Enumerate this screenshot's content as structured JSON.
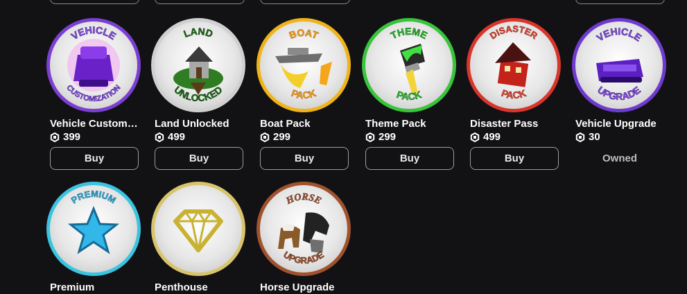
{
  "items": [
    {
      "name": "Vehicle Customiz...",
      "price": "399",
      "action": "Buy",
      "badge_top": "VEHICLE",
      "badge_bottom": "CUSTOMIZATION",
      "ring_color": "#7b3fd1",
      "icon": "purple-car-icon"
    },
    {
      "name": "Land Unlocked",
      "price": "499",
      "action": "Buy",
      "badge_top": "LAND",
      "badge_bottom": "UNLOCKED",
      "ring_color": "#c8c8c8",
      "icon": "house-on-island-icon"
    },
    {
      "name": "Boat Pack",
      "price": "299",
      "action": "Buy",
      "badge_top": "BOAT",
      "badge_bottom": "PACK",
      "ring_color": "#f0b419",
      "icon": "boats-icon"
    },
    {
      "name": "Theme Pack",
      "price": "299",
      "action": "Buy",
      "badge_top": "THEME",
      "badge_bottom": "PACK",
      "ring_color": "#39c43b",
      "icon": "paintbrush-icon"
    },
    {
      "name": "Disaster Pass",
      "price": "499",
      "action": "Buy",
      "badge_top": "DISASTER",
      "badge_bottom": "PACK",
      "ring_color": "#d9352b",
      "icon": "broken-house-icon"
    },
    {
      "name": "Vehicle Upgrade",
      "price": "30",
      "action": "Owned",
      "badge_top": "VEHICLE",
      "badge_bottom": "UPGRADE",
      "ring_color": "#6f3ad0",
      "icon": "purple-car-icon"
    },
    {
      "name": "Premium",
      "badge_top": "PREMIUM",
      "badge_bottom": "",
      "ring_color": "#3bc4e0",
      "icon": "star-icon"
    },
    {
      "name": "Penthouse",
      "badge_top": "",
      "badge_bottom": "",
      "ring_color": "#d8c46a",
      "icon": "diamond-icon"
    },
    {
      "name": "Horse Upgrade",
      "badge_top": "HORSE",
      "badge_bottom": "UPGRADE",
      "ring_color": "#a0522d",
      "icon": "horses-icon"
    }
  ]
}
